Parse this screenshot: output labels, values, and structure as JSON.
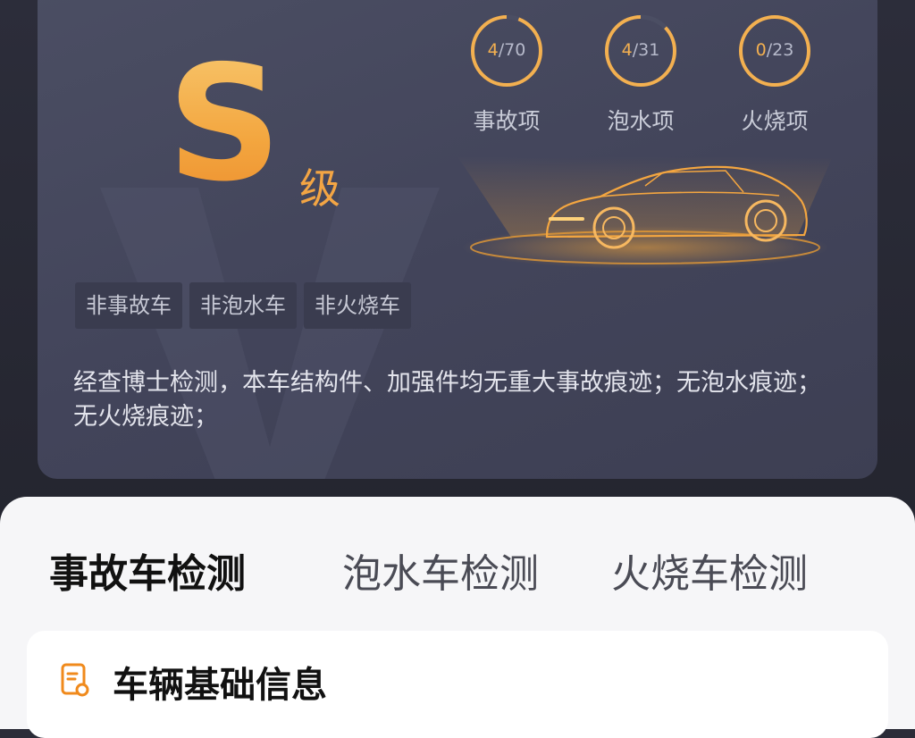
{
  "grade": {
    "letter": "S",
    "suffix": "级"
  },
  "checks": [
    {
      "label": "事故项",
      "found": "4",
      "total": "/70",
      "progress": 0.057
    },
    {
      "label": "泡水项",
      "found": "4",
      "total": "/31",
      "progress": 0.129
    },
    {
      "label": "火烧项",
      "found": "0",
      "total": "/23",
      "progress": 0.0
    }
  ],
  "tags": [
    "非事故车",
    "非泡水车",
    "非火烧车"
  ],
  "description": "经查博士检测，本车结构件、加强件均无重大事故痕迹；无泡水痕迹；无火烧痕迹；",
  "tabs": [
    {
      "label": "事故车检测",
      "active": true
    },
    {
      "label": "泡水车检测",
      "active": false
    },
    {
      "label": "火烧车检测",
      "active": false
    }
  ],
  "section": {
    "title": "车辆基础信息",
    "icon": "document-icon"
  },
  "colors": {
    "accent": "#f08a1c",
    "ring": "#f3b050",
    "card": "#45475c",
    "page": "#f6f6f8"
  }
}
